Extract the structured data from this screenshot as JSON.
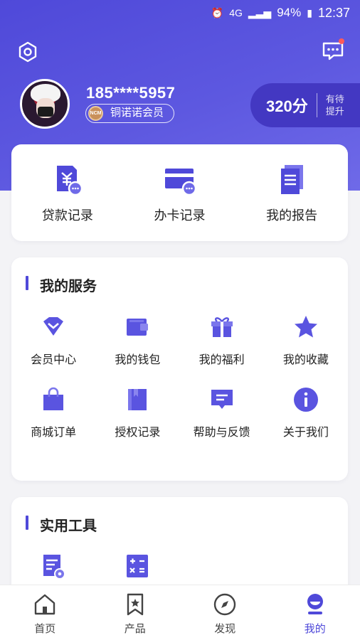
{
  "status_bar": {
    "battery": "94%",
    "time": "12:37",
    "network": "4G"
  },
  "profile": {
    "phone": "185****5957",
    "medal_text": "NCM",
    "member_level": "铜诺诺会员",
    "score": "320分",
    "score_hint": "有待提升"
  },
  "records": [
    {
      "label": "贷款记录",
      "icon": "loan-record-icon"
    },
    {
      "label": "办卡记录",
      "icon": "card-record-icon"
    },
    {
      "label": "我的报告",
      "icon": "report-icon"
    }
  ],
  "services": {
    "title": "我的服务",
    "items": [
      {
        "label": "会员中心",
        "icon": "diamond-icon"
      },
      {
        "label": "我的钱包",
        "icon": "wallet-icon"
      },
      {
        "label": "我的福利",
        "icon": "gift-icon"
      },
      {
        "label": "我的收藏",
        "icon": "star-icon"
      },
      {
        "label": "商城订单",
        "icon": "shopping-bag-icon"
      },
      {
        "label": "授权记录",
        "icon": "bookmark-book-icon"
      },
      {
        "label": "帮助与反馈",
        "icon": "feedback-icon"
      },
      {
        "label": "关于我们",
        "icon": "info-icon"
      }
    ]
  },
  "tools": {
    "title": "实用工具",
    "items": [
      {
        "icon": "settings-document-icon"
      },
      {
        "icon": "calculator-icon"
      }
    ]
  },
  "tabbar": {
    "items": [
      {
        "label": "首页",
        "icon": "home-icon",
        "active": false
      },
      {
        "label": "产品",
        "icon": "bookmark-icon",
        "active": false
      },
      {
        "label": "发现",
        "icon": "compass-icon",
        "active": false
      },
      {
        "label": "我的",
        "icon": "profile-icon",
        "active": true
      }
    ]
  },
  "colors": {
    "primary": "#4f49d9",
    "accent_light": "#7b76ec",
    "badge_dot": "#ff5a5a"
  }
}
